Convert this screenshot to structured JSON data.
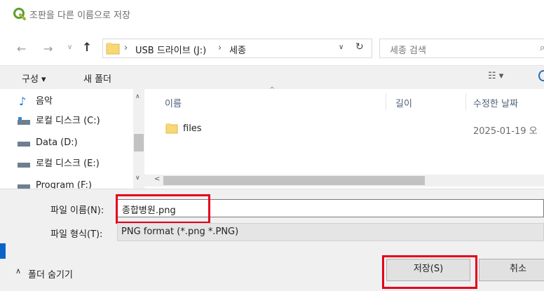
{
  "window": {
    "title": "조판을 다른 이름으로 저장"
  },
  "address": {
    "path": [
      "USB 드라이브 (J:)",
      "세종"
    ],
    "search_placeholder": "세종 검색"
  },
  "toolbar": {
    "organize": "구성 ▾",
    "new_folder": "새 폴더"
  },
  "nav": {
    "items": [
      {
        "label": "음악",
        "icon": "music-note-icon"
      },
      {
        "label": "로컬 디스크 (C:)",
        "icon": "drive-icon"
      },
      {
        "label": "Data (D:)",
        "icon": "drive-icon"
      },
      {
        "label": "로컬 디스크 (E:)",
        "icon": "drive-icon"
      },
      {
        "label": "Program (F:)",
        "icon": "drive-icon"
      }
    ]
  },
  "files": {
    "columns": {
      "name": "이름",
      "size": "길이",
      "modified": "수정한 날짜"
    },
    "rows": [
      {
        "name": "files",
        "modified": "2025-01-19 오"
      }
    ]
  },
  "form": {
    "filename_label": "파일 이름(N):",
    "filename_value": "종합병원.png",
    "filetype_label": "파일 형식(T):",
    "filetype_value": "PNG format (*.png *.PNG)",
    "hide_folders": "폴더 숨기기",
    "save": "저장(S)",
    "cancel": "취소"
  },
  "colors": {
    "highlight": "#e4001b",
    "folder": "#f8d775",
    "accent": "#0a64c8"
  }
}
